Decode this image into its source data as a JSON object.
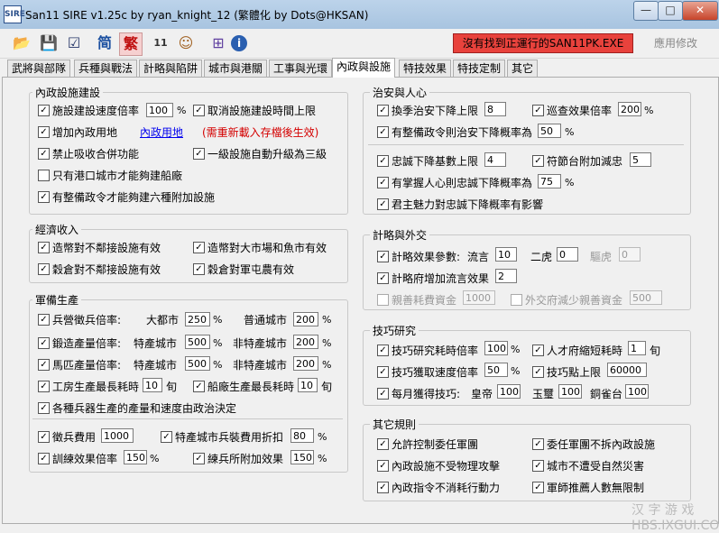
{
  "window": {
    "title": "San11 SIRE v1.25c by ryan_knight_12 (繁體化 by Dots@HKSAN)",
    "app_icon": "SIRE",
    "min": "—",
    "max": "□",
    "close": "✕"
  },
  "toolbar": {
    "status": "沒有找到正運行的SAN11PK.EXE",
    "apply": "應用修改",
    "icons": {
      "open": "📂",
      "save": "💾",
      "checklist": "☑",
      "simp": "简",
      "trad": "繁",
      "calendar": "11",
      "face": "☺",
      "calc": "⊞",
      "info": "i"
    }
  },
  "tabs": [
    "武將與部隊",
    "兵種與戰法",
    "計略與陷阱",
    "城市與港關",
    "工事與光環",
    "內政與設施",
    "特技效果",
    "特技定制",
    "其它"
  ],
  "groups": {
    "neizheng": {
      "title": "內政設施建設",
      "build_speed": "施設建設速度倍率",
      "build_speed_val": "100",
      "pct": "%",
      "cancel_limit": "取消設施建設時間上限",
      "add_land": "增加內政用地",
      "land_link": "內政用地",
      "land_note": "(需重新載入存檔後生效)",
      "forbid_merge": "禁止吸收合併功能",
      "auto_upgrade": "一級設施自動升級為三級",
      "port_shipyard": "只有港口城市才能夠建船廠",
      "six_facilities": "有整備政令才能夠建六種附加設施"
    },
    "economy": {
      "title": "經濟收入",
      "mint_no": "造幣對不鄰接設施有效",
      "mint_market": "造幣對大市場和魚市有效",
      "granary_no": "穀倉對不鄰接設施有效",
      "granary_farm": "穀倉對軍屯農有效"
    },
    "military": {
      "title": "軍備生產",
      "barracks": "兵營徵兵倍率:",
      "big_city": "大都市",
      "big_val": "250",
      "normal_city": "普通城市",
      "normal_val": "200",
      "forge": "鍛造產量倍率:",
      "special_city": "特產城市",
      "forge_sp": "500",
      "non_special": "非特產城市",
      "forge_ns": "200",
      "stable": "馬匹產量倍率:",
      "stable_sp": "500",
      "stable_ns": "200",
      "workshop": "工房生產最長耗時",
      "workshop_val": "10",
      "dockyard": "船廠生產最長耗時",
      "dockyard_val": "10",
      "xun": "旬",
      "politics": "各種兵器生產的產量和速度由政治決定",
      "draft_cost": "徵兵費用",
      "draft_val": "1000",
      "special_discount": "特產城市兵裝費用折扣",
      "discount_val": "80",
      "train": "訓練效果倍率",
      "train_val": "150",
      "drill": "練兵所附加效果",
      "drill_val": "150"
    },
    "security": {
      "title": "治安與人心",
      "season": "換季治安下降上限",
      "season_val": "8",
      "patrol": "巡查效果倍率",
      "patrol_val": "200",
      "decree_drop": "有整備政令則治安下降概率為",
      "decree_val": "50",
      "loyalty": "忠誠下降基數上限",
      "loyalty_val": "4",
      "festival": "符節台附加減忠",
      "festival_val": "5",
      "grip": "有掌握人心則忠誠下降概率為",
      "grip_val": "75",
      "charisma": "君主魅力對忠誠下降概率有影響"
    },
    "strategy": {
      "title": "計略與外交",
      "effect": "計略效果參數:",
      "rumor": "流言",
      "rumor_val": "10",
      "tiger": "二虎",
      "tiger_val": "0",
      "drive": "驅虎",
      "drive_val": "0",
      "office": "計略府增加流言效果",
      "office_val": "2",
      "friendly": "親善耗費資金",
      "friendly_val": "1000",
      "foreign": "外交府減少親善資金",
      "foreign_val": "500"
    },
    "tech": {
      "title": "技巧研究",
      "research": "技巧研究耗時倍率",
      "research_val": "100",
      "talent": "人才府縮短耗時",
      "talent_val": "1",
      "gain": "技巧獲取速度倍率",
      "gain_val": "50",
      "cap": "技巧點上限",
      "cap_val": "60000",
      "monthly": "每月獲得技巧:",
      "emperor": "皇帝",
      "emperor_val": "100",
      "seal": "玉璽",
      "seal_val": "100",
      "bronze": "銅雀台",
      "bronze_val": "100"
    },
    "misc": {
      "title": "其它規則",
      "allow_delegate": "允許控制委任軍團",
      "no_demolish": "委任軍團不拆內政設施",
      "no_physical": "內政設施不受物理攻擊",
      "no_disaster": "城市不遭受自然災害",
      "no_action": "內政指令不消耗行動力",
      "recommend": "軍師推薦人數無限制"
    }
  },
  "check": "✓",
  "watermark": "汉 字 游 戏 HBS.IXGUI.COM"
}
